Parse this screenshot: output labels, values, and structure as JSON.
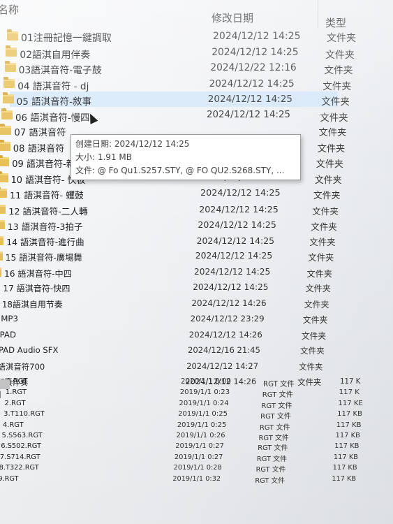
{
  "header": {
    "name": "名称",
    "date": "修改日期",
    "type": "类型"
  },
  "rows": [
    {
      "name": "01注冊記憶一鍵調取",
      "date": "2024/12/12 14:25",
      "type": "文件夹",
      "kind": "folder"
    },
    {
      "name": "02語淇自用伴奏",
      "date": "2024/12/12 14:25",
      "type": "文件夹",
      "kind": "folder"
    },
    {
      "name": "03語淇音符-電子鼓",
      "date": "2024/12/22 12:16",
      "type": "文件夹",
      "kind": "folder"
    },
    {
      "name": "04 語淇音符 - dj",
      "date": "2024/12/12 14:25",
      "type": "文件夹",
      "kind": "folder"
    },
    {
      "name": "05 語淇音符-敘事",
      "date": "2024/12/12 14:25",
      "type": "文件夹",
      "kind": "folder"
    },
    {
      "name": "06 語淇音符-慢四",
      "date": "2024/12/12 14:25",
      "type": "文件夹",
      "kind": "folder"
    },
    {
      "name": "07 語淇音符",
      "date": "",
      "type": "文件夹",
      "kind": "folder"
    },
    {
      "name": "08 語淇音符",
      "date": "",
      "type": "文件夹",
      "kind": "folder"
    },
    {
      "name": "09 語淇音符-新疆",
      "date": "2024/12/12 14:25",
      "type": "文件夹",
      "kind": "folder"
    },
    {
      "name": "10 語淇音符- 快板",
      "date": "2024/12/12 14:25",
      "type": "文件夹",
      "kind": "folder"
    },
    {
      "name": "11 語淇音符- 蠼鼓",
      "date": "2024/12/12 14:25",
      "type": "文件夹",
      "kind": "folder"
    },
    {
      "name": "12 語淇音符-二人轉",
      "date": "2024/12/12 14:25",
      "type": "文件夹",
      "kind": "folder"
    },
    {
      "name": "13 語淇音符-3拍子",
      "date": "2024/12/12 14:25",
      "type": "文件夹",
      "kind": "folder"
    },
    {
      "name": "14 語淇音符-進行曲",
      "date": "2024/12/12 14:25",
      "type": "文件夹",
      "kind": "folder"
    },
    {
      "name": "15 語淇音符-廣場舞",
      "date": "2024/12/12 14:25",
      "type": "文件夹",
      "kind": "folder"
    },
    {
      "name": "16 語淇音符-中四",
      "date": "2024/12/12 14:25",
      "type": "文件夹",
      "kind": "folder"
    },
    {
      "name": "17 語淇音符-快四",
      "date": "2024/12/12 14:25",
      "type": "文件夹",
      "kind": "folder"
    },
    {
      "name": "18語淇自用节奏",
      "date": "2024/12/12 14:26",
      "type": "文件夹",
      "kind": "folder"
    },
    {
      "name": "MP3",
      "date": "2024/12/12 23:29",
      "type": "文件夹",
      "kind": "folder"
    },
    {
      "name": "PAD",
      "date": "2024/12/12 14:26",
      "type": "文件夹",
      "kind": "folder"
    },
    {
      "name": "PAD Audio SFX",
      "date": "2024/12/16 21:45",
      "type": "文件夹",
      "kind": "folder"
    },
    {
      "name": "語淇音符700",
      "date": "2024/12/12 14:27",
      "type": "文件夹",
      "kind": "folder"
    },
    {
      "name": "原版伴奏",
      "date": "2024/12/12 14:26",
      "type": "文件夹",
      "kind": "folder"
    },
    {
      "name": "0.RGT",
      "date": "2020/1/1 0:00",
      "type": "RGT 文件",
      "size": "117 K",
      "kind": "file"
    },
    {
      "name": "1.RGT",
      "date": "2019/1/1 0:23",
      "type": "RGT 文件",
      "size": "117 K",
      "kind": "file"
    },
    {
      "name": "2.RGT",
      "date": "2019/1/1 0:24",
      "type": "RGT 文件",
      "size": "117 KE",
      "kind": "file"
    },
    {
      "name": "3.T110.RGT",
      "date": "2019/1/1 0:25",
      "type": "RGT 文件",
      "size": "117 KB",
      "kind": "file"
    },
    {
      "name": "4.RGT",
      "date": "2019/1/1 0:25",
      "type": "RGT 文件",
      "size": "117 KB",
      "kind": "file"
    },
    {
      "name": "5.S563.RGT",
      "date": "2019/1/1 0:26",
      "type": "RGT 文件",
      "size": "117 KB",
      "kind": "file"
    },
    {
      "name": "6.S502.RGT",
      "date": "2019/1/1 0:27",
      "type": "RGT 文件",
      "size": "117 KB",
      "kind": "file"
    },
    {
      "name": "7.S714.RGT",
      "date": "2019/1/1 0:27",
      "type": "RGT 文件",
      "size": "117 KB",
      "kind": "file"
    },
    {
      "name": "8.T322.RGT",
      "date": "2019/1/1 0:28",
      "type": "RGT 文件",
      "size": "117 KB",
      "kind": "file"
    },
    {
      "name": "9.RGT",
      "date": "2019/1/1 0:32",
      "type": "RGT 文件",
      "size": "117 KB",
      "kind": "file"
    }
  ],
  "tooltip": {
    "created": "创建日期: 2024/12/12 14:25",
    "size": "大小: 1.91 MB",
    "files": "文件: @ Fo Qu1.S257.STY, @ FO QU2.S268.STY, ..."
  },
  "colors": {
    "folder": "#e8c15a",
    "hover": "#cde4fa",
    "tooltip_border": "#9a9a9a"
  },
  "hovered_row": 4
}
